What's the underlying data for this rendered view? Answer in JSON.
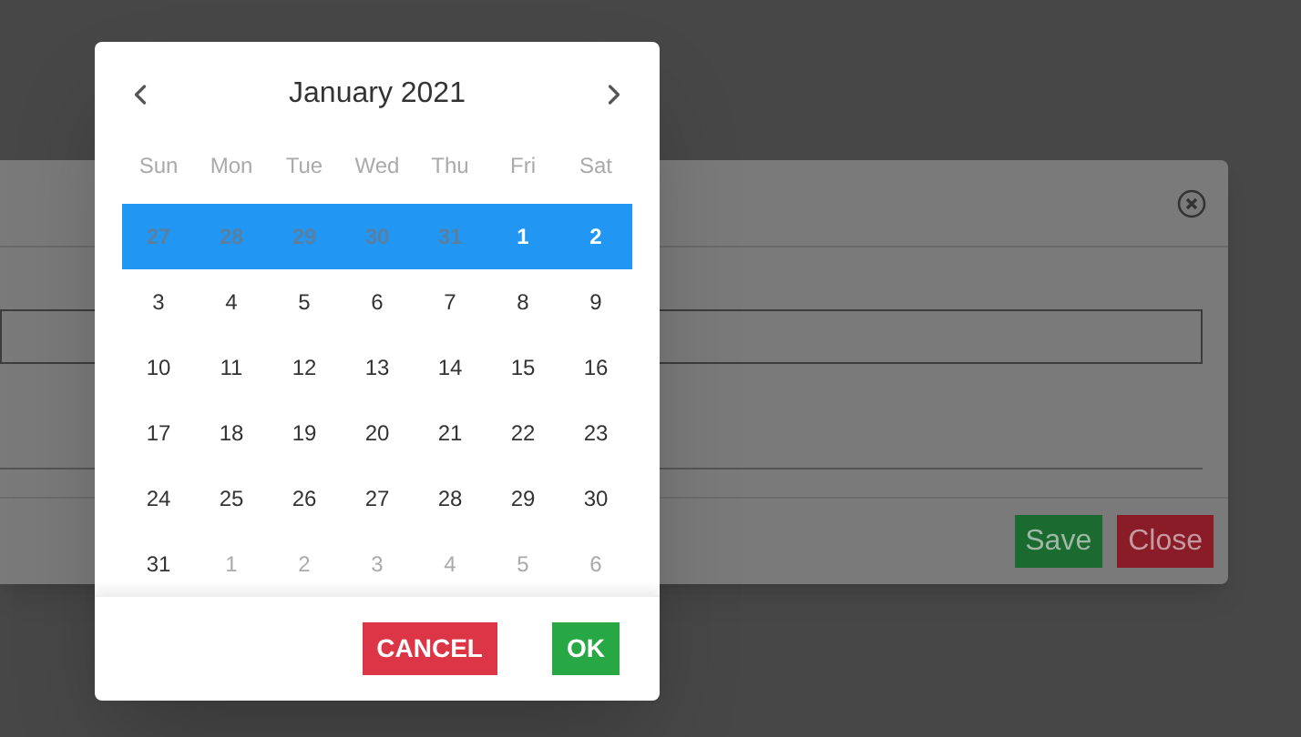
{
  "dialog": {
    "buttons": [
      {
        "label": "Save",
        "kind": "save"
      },
      {
        "label": "Close",
        "kind": "close"
      }
    ]
  },
  "calendar": {
    "title": "January 2021",
    "weekdays": [
      "Sun",
      "Mon",
      "Tue",
      "Wed",
      "Thu",
      "Fri",
      "Sat"
    ],
    "weeks": [
      {
        "selected": true,
        "days": [
          {
            "label": "27",
            "outside": true
          },
          {
            "label": "28",
            "outside": true
          },
          {
            "label": "29",
            "outside": true
          },
          {
            "label": "30",
            "outside": true
          },
          {
            "label": "31",
            "outside": true
          },
          {
            "label": "1",
            "outside": false
          },
          {
            "label": "2",
            "outside": false
          }
        ]
      },
      {
        "selected": false,
        "days": [
          {
            "label": "3",
            "outside": false
          },
          {
            "label": "4",
            "outside": false
          },
          {
            "label": "5",
            "outside": false
          },
          {
            "label": "6",
            "outside": false
          },
          {
            "label": "7",
            "outside": false
          },
          {
            "label": "8",
            "outside": false
          },
          {
            "label": "9",
            "outside": false
          }
        ]
      },
      {
        "selected": false,
        "days": [
          {
            "label": "10",
            "outside": false
          },
          {
            "label": "11",
            "outside": false
          },
          {
            "label": "12",
            "outside": false
          },
          {
            "label": "13",
            "outside": false
          },
          {
            "label": "14",
            "outside": false
          },
          {
            "label": "15",
            "outside": false
          },
          {
            "label": "16",
            "outside": false
          }
        ]
      },
      {
        "selected": false,
        "days": [
          {
            "label": "17",
            "outside": false
          },
          {
            "label": "18",
            "outside": false
          },
          {
            "label": "19",
            "outside": false
          },
          {
            "label": "20",
            "outside": false
          },
          {
            "label": "21",
            "outside": false
          },
          {
            "label": "22",
            "outside": false
          },
          {
            "label": "23",
            "outside": false
          }
        ]
      },
      {
        "selected": false,
        "days": [
          {
            "label": "24",
            "outside": false
          },
          {
            "label": "25",
            "outside": false
          },
          {
            "label": "26",
            "outside": false
          },
          {
            "label": "27",
            "outside": false
          },
          {
            "label": "28",
            "outside": false
          },
          {
            "label": "29",
            "outside": false
          },
          {
            "label": "30",
            "outside": false
          }
        ]
      },
      {
        "selected": false,
        "days": [
          {
            "label": "31",
            "outside": false
          },
          {
            "label": "1",
            "outside": true
          },
          {
            "label": "2",
            "outside": true
          },
          {
            "label": "3",
            "outside": true
          },
          {
            "label": "4",
            "outside": true
          },
          {
            "label": "5",
            "outside": true
          },
          {
            "label": "6",
            "outside": true
          }
        ]
      }
    ],
    "buttons": [
      {
        "label": "CANCEL",
        "kind": "cancel"
      },
      {
        "label": "OK",
        "kind": "ok"
      }
    ]
  }
}
